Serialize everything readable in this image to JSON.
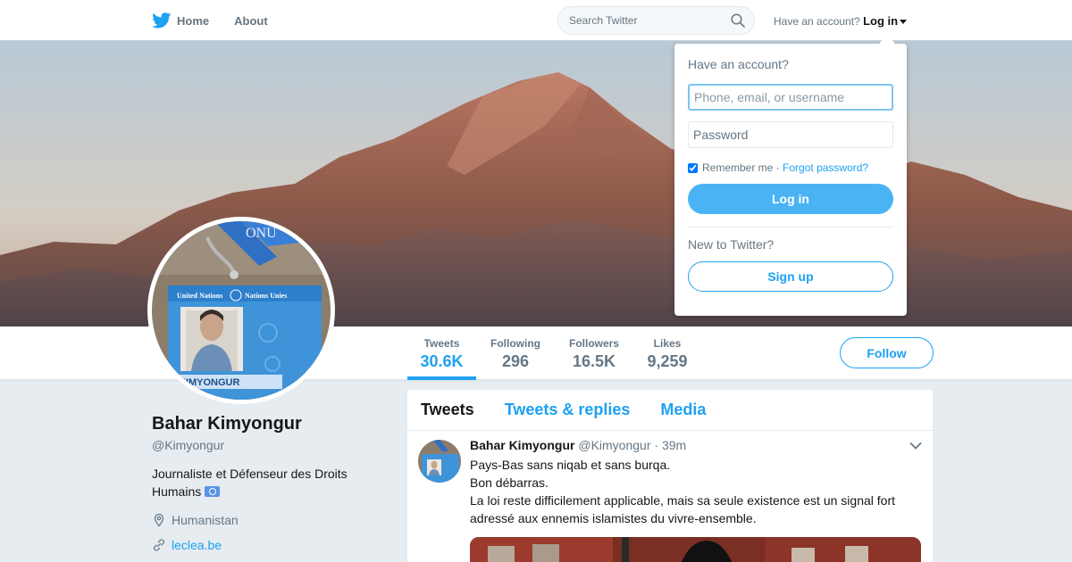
{
  "nav": {
    "home": "Home",
    "about": "About",
    "search_placeholder": "Search Twitter",
    "have_account": "Have an account?",
    "login": "Log in"
  },
  "login_dropdown": {
    "title": "Have an account?",
    "username_placeholder": "Phone, email, or username",
    "password_placeholder": "Password",
    "remember_me": "Remember me",
    "separator": "·",
    "forgot_password": "Forgot password?",
    "login_button": "Log in",
    "new_to_twitter": "New to Twitter?",
    "signup_button": "Sign up"
  },
  "avatar": {
    "badge_org": "United Nations",
    "badge_org_fr": "Nations Unies",
    "badge_name": "KIMYONGUR",
    "lanyard_text": "ONU"
  },
  "stats": [
    {
      "label": "Tweets",
      "value": "30.6K",
      "active": true
    },
    {
      "label": "Following",
      "value": "296",
      "active": false
    },
    {
      "label": "Followers",
      "value": "16.5K",
      "active": false
    },
    {
      "label": "Likes",
      "value": "9,259",
      "active": false
    }
  ],
  "follow_button": "Follow",
  "profile": {
    "name": "Bahar Kimyongur",
    "handle": "@Kimyongur",
    "bio": "Journaliste et Défenseur des Droits Humains",
    "location": "Humanistan",
    "website": "leclea.be"
  },
  "timeline": {
    "tabs": [
      "Tweets",
      "Tweets & replies",
      "Media"
    ],
    "tweet": {
      "name": "Bahar Kimyongur",
      "handle": "@Kimyongur",
      "dot": "·",
      "time": "39m",
      "lines": [
        "Pays-Bas sans niqab et sans burqa.",
        "Bon débarras.",
        "La loi reste difficilement applicable, mais sa seule existence est un signal fort adressé aux ennemis islamistes du vivre-ensemble."
      ]
    }
  },
  "colors": {
    "brand_blue": "#1da1f2",
    "login_blue": "#4ab3f4",
    "muted_text": "#657786"
  }
}
